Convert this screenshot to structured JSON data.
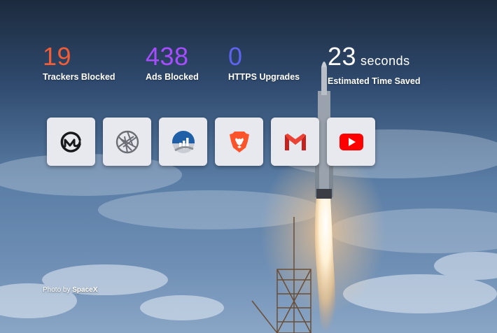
{
  "stats": {
    "trackers": {
      "value": "19",
      "label": "Trackers Blocked",
      "color": "#f25c36"
    },
    "ads": {
      "value": "438",
      "label": "Ads Blocked",
      "color": "#a64dff"
    },
    "https": {
      "value": "0",
      "label": "HTTPS Upgrades",
      "color": "#5e63f0"
    },
    "time": {
      "value": "23",
      "unit": "seconds",
      "label": "Estimated Time Saved",
      "color": "#ffffff"
    }
  },
  "shortcuts": [
    {
      "icon": "coinmarketcap-icon"
    },
    {
      "icon": "aperture-icon"
    },
    {
      "icon": "chart-logo-icon"
    },
    {
      "icon": "brave-lion-icon"
    },
    {
      "icon": "gmail-icon"
    },
    {
      "icon": "youtube-icon"
    }
  ],
  "credit": {
    "prefix": "Photo by",
    "author": "SpaceX"
  }
}
